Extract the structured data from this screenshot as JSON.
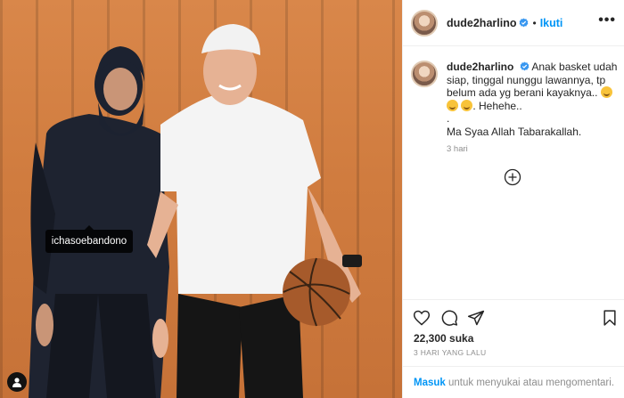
{
  "post": {
    "username": "dude2harlino",
    "follow_label": "Ikuti",
    "more_label": "•••",
    "separator": "•"
  },
  "photo": {
    "tagged_user": "ichasoebandono"
  },
  "caption": {
    "username": "dude2harlino",
    "line1": "Anak basket udah siap, tinggal nunggu lawannya, tp belum ada yg berani kayaknya..",
    "line2": ". Hehehe..",
    "line3": ".",
    "line4": "Ma Syaa Allah Tabarakallah.",
    "time": "3 hari"
  },
  "engagement": {
    "likes": "22,300 suka",
    "posted_ago": "3 HARI YANG LALU"
  },
  "footer": {
    "login_link": "Masuk",
    "rest": " untuk menyukai atau mengomentari."
  },
  "icons": {
    "verified": "verified-badge-icon",
    "heart": "heart-icon",
    "comment": "comment-icon",
    "share": "share-icon",
    "save": "bookmark-icon",
    "load_more": "plus-circle-icon",
    "user_tag": "user-tag-icon"
  },
  "colors": {
    "link_blue": "#0095f6",
    "verified_blue": "#3897f0",
    "muted_gray": "#8e8e8e",
    "text_dark": "#262626"
  }
}
